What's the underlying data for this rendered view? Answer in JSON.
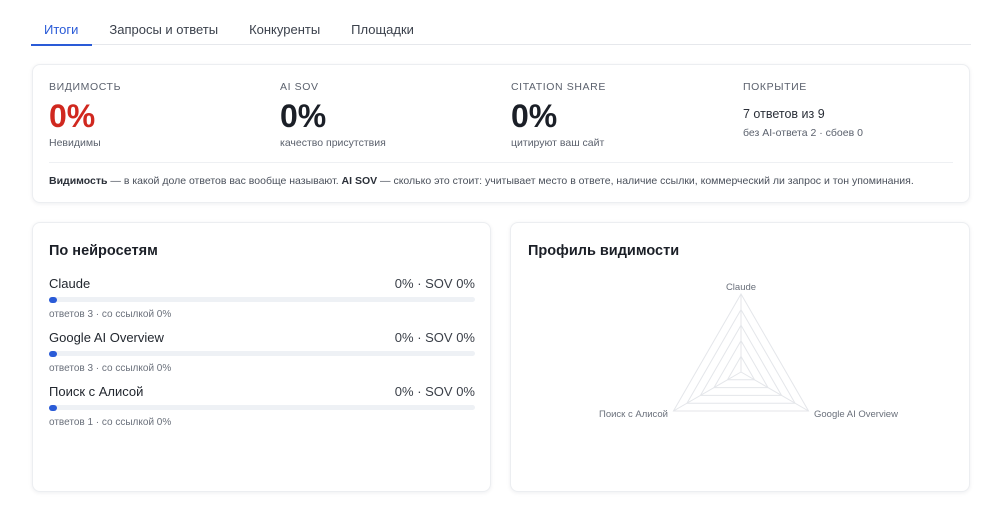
{
  "tabs": [
    {
      "label": "Итоги",
      "active": true
    },
    {
      "label": "Запросы и ответы",
      "active": false
    },
    {
      "label": "Конкуренты",
      "active": false
    },
    {
      "label": "Площадки",
      "active": false
    }
  ],
  "summary": {
    "visibility": {
      "label": "ВИДИМОСТЬ",
      "value": "0%",
      "sub": "Невидимы"
    },
    "ai_sov": {
      "label": "AI SOV",
      "value": "0%",
      "sub": "качество присутствия"
    },
    "citation_share": {
      "label": "CITATION SHARE",
      "value": "0%",
      "sub": "цитируют ваш сайт"
    },
    "coverage": {
      "label": "ПОКРЫТИЕ",
      "main": "7 ответов из 9",
      "sub": "без AI-ответа 2 · сбоев 0"
    },
    "explain": {
      "term1": "Видимость",
      "text1": " — в какой доле ответов вас вообще называют. ",
      "term2": "AI SOV",
      "text2": " — сколько это стоит: учитывает место в ответе, наличие ссылки, коммерческий ли запрос и тон упоминания."
    }
  },
  "models_card": {
    "title": "По нейросетям",
    "items": [
      {
        "name": "Claude",
        "value": "0% · SOV 0%",
        "meta": "ответов 3 · со ссылкой 0%",
        "progress": 0
      },
      {
        "name": "Google AI Overview",
        "value": "0% · SOV 0%",
        "meta": "ответов 3 · со ссылкой 0%",
        "progress": 0
      },
      {
        "name": "Поиск с Алисой",
        "value": "0% · SOV 0%",
        "meta": "ответов 1 · со ссылкой 0%",
        "progress": 0
      }
    ]
  },
  "profile_card": {
    "title": "Профиль видимости",
    "axes": [
      "Claude",
      "Google AI Overview",
      "Поиск с Алисой"
    ],
    "values": [
      0,
      0,
      0
    ]
  },
  "colors": {
    "accent": "#2a5bd7",
    "danger": "#d0281f"
  }
}
